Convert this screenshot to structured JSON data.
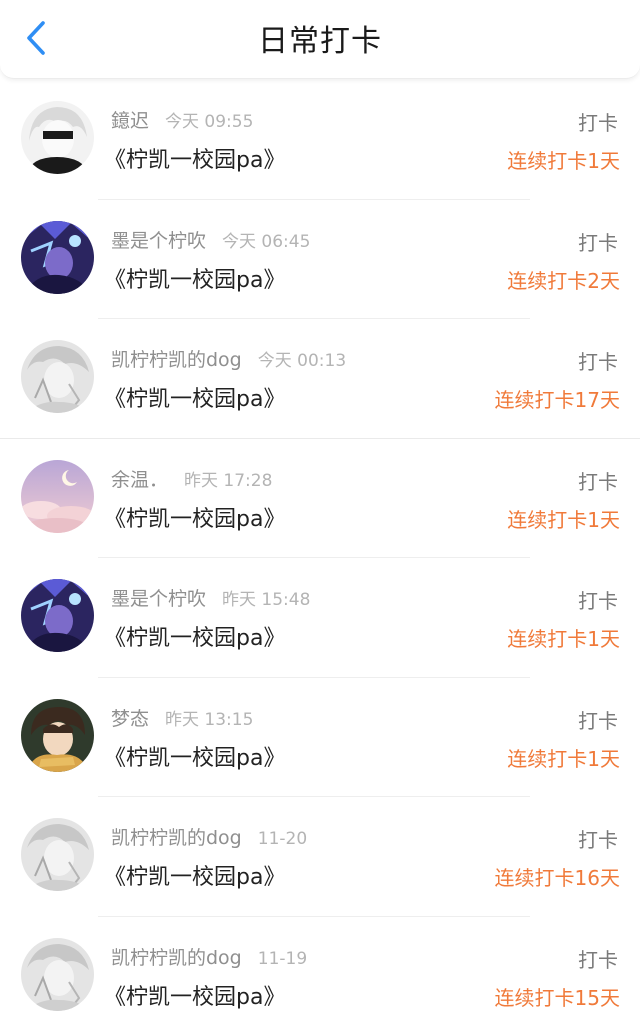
{
  "header": {
    "title": "日常打卡",
    "back_icon": "chevron-left-icon",
    "accent": "#2f8ef4"
  },
  "colors": {
    "streak": "#f07a3a",
    "name": "#8f8f8f",
    "time": "#b4b4b4"
  },
  "items": [
    {
      "user": "鐿迟",
      "time": "今天 09:55",
      "topic": "《柠凯一校园pa》",
      "type": "打卡",
      "streak": "连续打卡1天",
      "avatar": "avatar-white-hair"
    },
    {
      "user": "墨是个柠吹",
      "time": "今天 06:45",
      "topic": "《柠凯一校园pa》",
      "type": "打卡",
      "streak": "连续打卡2天",
      "avatar": "avatar-blue-purple"
    },
    {
      "user": "凯柠柠凯的dog",
      "time": "今天 00:13",
      "topic": "《柠凯一校园pa》",
      "type": "打卡",
      "streak": "连续打卡17天",
      "avatar": "avatar-gray-sketch"
    },
    {
      "user": "余温．",
      "time": "昨天 17:28",
      "topic": "《柠凯一校园pa》",
      "type": "打卡",
      "streak": "连续打卡1天",
      "avatar": "avatar-pink-sky-moon"
    },
    {
      "user": "墨是个柠吹",
      "time": "昨天 15:48",
      "topic": "《柠凯一校园pa》",
      "type": "打卡",
      "streak": "连续打卡1天",
      "avatar": "avatar-blue-purple"
    },
    {
      "user": "梦态",
      "time": "昨天 13:15",
      "topic": "《柠凯一校园pa》",
      "type": "打卡",
      "streak": "连续打卡1天",
      "avatar": "avatar-anime-boy"
    },
    {
      "user": "凯柠柠凯的dog",
      "time": "11-20",
      "topic": "《柠凯一校园pa》",
      "type": "打卡",
      "streak": "连续打卡16天",
      "avatar": "avatar-gray-sketch"
    },
    {
      "user": "凯柠柠凯的dog",
      "time": "11-19",
      "topic": "《柠凯一校园pa》",
      "type": "打卡",
      "streak": "连续打卡15天",
      "avatar": "avatar-gray-sketch"
    }
  ]
}
